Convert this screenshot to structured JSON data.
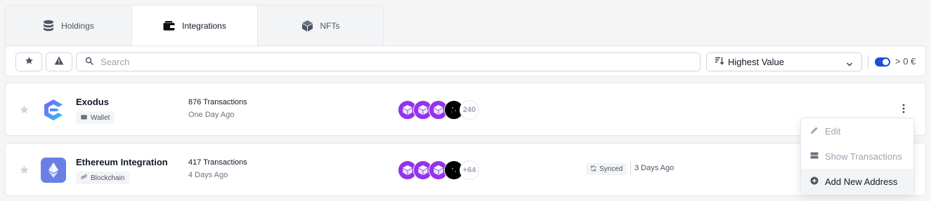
{
  "tabs": [
    {
      "label": "Holdings",
      "icon": "database-icon",
      "active": false
    },
    {
      "label": "Integrations",
      "icon": "wallet-icon",
      "active": true
    },
    {
      "label": "NFTs",
      "icon": "cube-icon",
      "active": false
    }
  ],
  "toolbar": {
    "search_placeholder": "Search",
    "sort_label": "Highest Value",
    "threshold_label": "> 0 €",
    "threshold_toggle_on": true
  },
  "integrations": [
    {
      "name": "Exodus",
      "type_label": "Wallet",
      "type_icon": "wallet-icon",
      "transactions": "876 Transactions",
      "last_activity": "One Day Ago",
      "nft_more": "240",
      "synced_label": "",
      "synced_date": ""
    },
    {
      "name": "Ethereum Integration",
      "type_label": "Blockchain",
      "type_icon": "link-icon",
      "transactions": "417 Transactions",
      "last_activity": "4 Days Ago",
      "nft_more": "+64",
      "synced_label": "Synced",
      "synced_date": "3 Days Ago"
    }
  ],
  "context_menu": {
    "items": [
      {
        "label": "Edit",
        "icon": "pencil-icon",
        "disabled": true
      },
      {
        "label": "Show Transactions",
        "icon": "list-icon",
        "disabled": true
      },
      {
        "label": "Add New Address",
        "icon": "plus-circle-icon",
        "disabled": false
      }
    ]
  },
  "colors": {
    "accent": "#1d4ed8",
    "nft_purple": "#9333ea",
    "exodus_blue": "#4f7cf7",
    "ethereum_bg": "#6a7fe6"
  }
}
